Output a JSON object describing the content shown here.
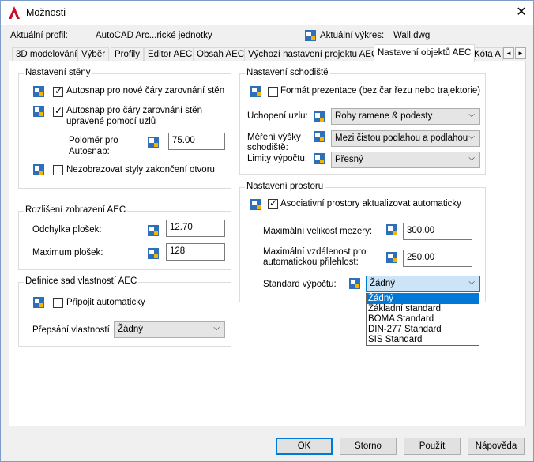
{
  "window": {
    "title": "Možnosti",
    "close_glyph": "✕"
  },
  "header": {
    "profile_label": "Aktuální profil:",
    "profile_value": "AutoCAD Arc...rické jednotky",
    "drawing_label": "Aktuální výkres:",
    "drawing_value": "Wall.dwg"
  },
  "tabs": [
    {
      "label": "3D modelování"
    },
    {
      "label": "Výběr"
    },
    {
      "label": "Profily"
    },
    {
      "label": "Editor AEC"
    },
    {
      "label": "Obsah AEC"
    },
    {
      "label": "Výchozí nastavení projektu AEC"
    },
    {
      "label": "Nastavení objektů AEC"
    },
    {
      "label": "Kóta A"
    }
  ],
  "tab_scroll": {
    "left": "◄",
    "right": "►"
  },
  "wall_settings": {
    "title": "Nastavení stěny",
    "autosnap_new": "Autosnap pro nové čáry zarovnání stěn",
    "autosnap_modified_1": "Autosnap pro čáry zarovnání stěn",
    "autosnap_modified_2": "upravené pomocí uzlů",
    "radius_label_1": "Poloměr pro",
    "radius_label_2": "Autosnap:",
    "radius_value": "75.00",
    "hide_opening": "Nezobrazovat styly zakončení otvoru"
  },
  "display_resolution": {
    "title": "Rozlišení zobrazení AEC",
    "deviation_label": "Odchylka plošek:",
    "deviation_value": "12.70",
    "max_label": "Maximum plošek:",
    "max_value": "128"
  },
  "property_sets": {
    "title": "Definice sad vlastností AEC",
    "attach_auto": "Připojit automaticky",
    "override_label": "Přepsání vlastností",
    "override_value": "Žádný"
  },
  "stair_settings": {
    "title": "Nastavení schodiště",
    "presentation_format": "Formát prezentace (bez čar řezu nebo trajektorie)",
    "node_grip_label": "Uchopení uzlu:",
    "node_grip_value": "Rohy ramene & podesty",
    "height_label_1": "Měření výšky",
    "height_label_2": "schodiště:",
    "height_value": "Mezi čistou podlahou a podlahou",
    "calc_limits_label": "Limity výpočtu:",
    "calc_limits_value": "Přesný"
  },
  "space_settings": {
    "title": "Nastavení prostoru",
    "assoc_update": "Asociativní prostory aktualizovat automaticky",
    "max_gap_label": "Maximální velikost mezery:",
    "max_gap_value": "300.00",
    "max_dist_label_1": "Maximální vzdálenost pro",
    "max_dist_label_2": "automatickou přilehlost:",
    "max_dist_value": "250.00",
    "calc_standard_label": "Standard výpočtu:",
    "calc_standard_value": "Žádný",
    "calc_standard_options": [
      "Žádný",
      "Základní standard",
      "BOMA Standard",
      "DIN-277 Standard",
      "SIS Standard"
    ]
  },
  "buttons": {
    "ok": "OK",
    "cancel": "Storno",
    "apply": "Použít",
    "help": "Nápověda"
  },
  "colors": {
    "accent": "#0078d7",
    "panel": "#ffffff",
    "dialog_bg": "#f0f0f0"
  }
}
